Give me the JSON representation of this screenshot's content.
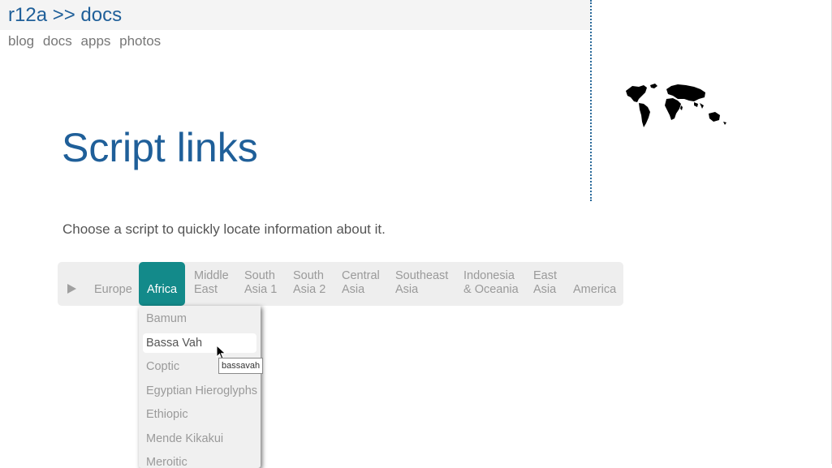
{
  "header": {
    "breadcrumb": "r12a >> docs",
    "nav": [
      "blog",
      "docs",
      "apps",
      "photos"
    ]
  },
  "page": {
    "title": "Script links",
    "intro": "Choose a script to quickly locate information about it."
  },
  "tabs": [
    {
      "line1": "",
      "line2": "Europe"
    },
    {
      "line1": "",
      "line2": "Africa"
    },
    {
      "line1": "Middle",
      "line2": "East"
    },
    {
      "line1": "South",
      "line2": "Asia 1"
    },
    {
      "line1": "South",
      "line2": "Asia 2"
    },
    {
      "line1": "Central",
      "line2": "Asia"
    },
    {
      "line1": "Southeast",
      "line2": "Asia"
    },
    {
      "line1": "Indonesia",
      "line2": "& Oceania"
    },
    {
      "line1": "East",
      "line2": "Asia"
    },
    {
      "line1": "",
      "line2": "America"
    }
  ],
  "active_tab": "Africa",
  "dropdown": {
    "items": [
      "Bamum",
      "Bassa Vah",
      "Coptic",
      "Egyptian Hieroglyphs",
      "Ethiopic",
      "Mende Kikakui",
      "Meroitic"
    ],
    "hovered": "Bassa Vah",
    "tooltip": "bassavah"
  },
  "icons": {
    "expand_arrow": "play-arrow-icon",
    "world_map": "world-map-icon",
    "cursor": "mouse-pointer-icon"
  },
  "colors": {
    "link_blue": "#1f5f99",
    "active_tab": "#138a8a",
    "tabbar_bg": "#eeeeee"
  }
}
